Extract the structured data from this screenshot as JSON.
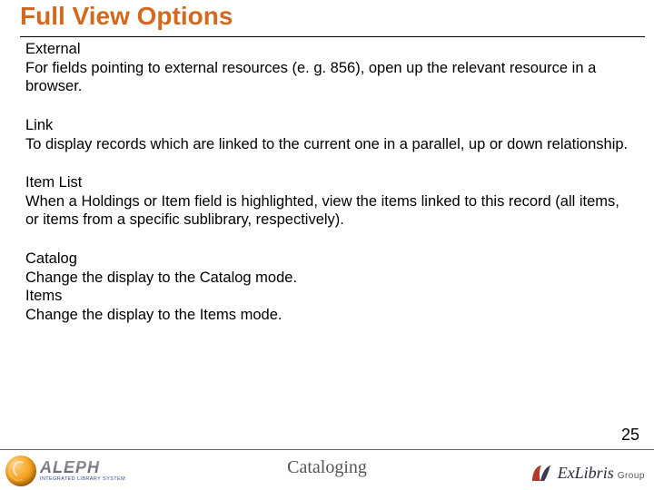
{
  "title": "Full View Options",
  "sections": [
    {
      "heading": "External",
      "text": "For fields pointing to external resources (e. g. 856), open up the relevant resource in a browser."
    },
    {
      "heading": "Link",
      "text": "To display records which are linked to the current one in a parallel, up or down relationship."
    },
    {
      "heading": "Item List",
      "text": "When a Holdings or Item field is highlighted, view the items linked to this record (all items, or items from a specific sublibrary, respectively)."
    },
    {
      "heading": "Catalog",
      "text": "Change the display to the Catalog mode."
    },
    {
      "heading": "Items",
      "text": "Change the display to the Items mode."
    }
  ],
  "page_number": "25",
  "footer_label": "Cataloging",
  "logos": {
    "aleph_word": "ALEPH",
    "aleph_sub": "INTEGRATED LIBRARY SYSTEM",
    "exlibris_main": "ExLibris",
    "exlibris_group": "Group"
  }
}
